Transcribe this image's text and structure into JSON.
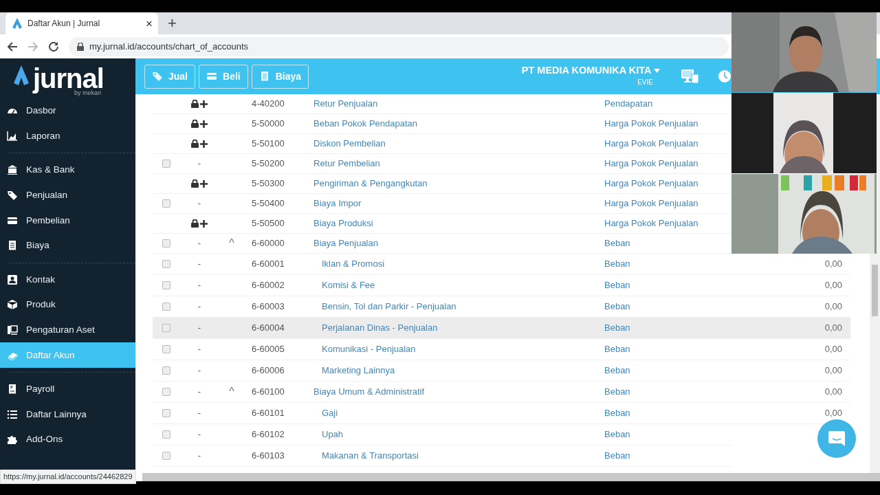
{
  "browser": {
    "tab_title": "Daftar Akun | Jurnal",
    "close": "×",
    "new_tab": "+",
    "url": "my.jurnal.id/accounts/chart_of_accounts",
    "forward_disabled": true
  },
  "sidebar": {
    "logo": "jurnal",
    "logo_sub": "by mekari",
    "groups": [
      {
        "items": [
          {
            "label": "Dasbor",
            "selected": false
          },
          {
            "label": "Laporan",
            "selected": false
          }
        ]
      },
      {
        "items": [
          {
            "label": "Kas & Bank",
            "selected": false
          },
          {
            "label": "Penjualan",
            "selected": false
          },
          {
            "label": "Pembelian",
            "selected": false
          },
          {
            "label": "Biaya",
            "selected": false
          }
        ]
      },
      {
        "items": [
          {
            "label": "Kontak",
            "selected": false
          },
          {
            "label": "Produk",
            "selected": false
          },
          {
            "label": "Pengaturan Aset",
            "selected": false
          },
          {
            "label": "Daftar Akun",
            "selected": true
          }
        ]
      },
      {
        "items": [
          {
            "label": "Payroll",
            "selected": false
          },
          {
            "label": "Daftar Lainnya",
            "selected": false
          },
          {
            "label": "Add-Ons",
            "selected": false
          }
        ]
      }
    ]
  },
  "header": {
    "buttons": [
      {
        "label": "Jual"
      },
      {
        "label": "Beli"
      },
      {
        "label": "Biaya"
      }
    ],
    "company": "PT MEDIA KOMUNIKA KITA",
    "user": "EVIE"
  },
  "table": {
    "rows": [
      {
        "kind": "locked",
        "code": "4-40200",
        "name": "Retur Penjualan",
        "category": "Pendapatan",
        "highlighted": false
      },
      {
        "kind": "locked",
        "code": "5-50000",
        "name": "Beban Pokok Pendapatan",
        "category": "Harga Pokok Penjualan",
        "highlighted": false
      },
      {
        "kind": "locked",
        "code": "5-50100",
        "name": "Diskon Pembelian",
        "category": "Harga Pokok Penjualan",
        "highlighted": false
      },
      {
        "kind": "checkbox",
        "checked": false,
        "dash": "-",
        "code": "5-50200",
        "name": "Retur Pembelian",
        "category": "Harga Pokok Penjualan",
        "highlighted": false
      },
      {
        "kind": "locked",
        "code": "5-50300",
        "name": "Pengiriman & Pengangkutan",
        "category": "Harga Pokok Penjualan",
        "highlighted": false
      },
      {
        "kind": "checkbox",
        "checked": false,
        "dash": "-",
        "code": "5-50400",
        "name": "Biaya Impor",
        "category": "Harga Pokok Penjualan",
        "highlighted": false
      },
      {
        "kind": "locked",
        "code": "5-50500",
        "name": "Biaya Produksi",
        "category": "Harga Pokok Penjualan",
        "highlighted": false
      },
      {
        "kind": "checkbox",
        "checked": false,
        "dash": "-",
        "toggle": "^",
        "code": "6-60000",
        "name": "Biaya Penjualan",
        "category": "Beban",
        "highlighted": false,
        "children": [
          {
            "kind": "checkbox",
            "checked": false,
            "dash": "-",
            "code": "6-60001",
            "name": "Iklan & Promosi",
            "category": "Beban",
            "balance": "0,00",
            "highlighted": false
          },
          {
            "kind": "checkbox",
            "checked": false,
            "dash": "-",
            "code": "6-60002",
            "name": "Komisi & Fee",
            "category": "Beban",
            "balance": "0,00",
            "highlighted": false
          },
          {
            "kind": "checkbox",
            "checked": false,
            "dash": "-",
            "code": "6-60003",
            "name": "Bensin, Tol dan Parkir - Penjualan",
            "category": "Beban",
            "balance": "0,00",
            "highlighted": false
          },
          {
            "kind": "checkbox",
            "checked": false,
            "dash": "-",
            "code": "6-60004",
            "name": "Perjalanan Dinas - Penjualan",
            "category": "Beban",
            "balance": "0,00",
            "highlighted": true
          },
          {
            "kind": "checkbox",
            "checked": false,
            "dash": "-",
            "code": "6-60005",
            "name": "Komunikasi - Penjualan",
            "category": "Beban",
            "balance": "0,00",
            "highlighted": false
          },
          {
            "kind": "checkbox",
            "checked": false,
            "dash": "-",
            "code": "6-60006",
            "name": "Marketing Lainnya",
            "category": "Beban",
            "balance": "0,00",
            "highlighted": false
          }
        ]
      },
      {
        "kind": "checkbox",
        "checked": false,
        "dash": "-",
        "toggle": "^",
        "code": "6-60100",
        "name": "Biaya Umum & Administratif",
        "category": "Beban",
        "balance": "0,00",
        "highlighted": false,
        "children": [
          {
            "kind": "checkbox",
            "checked": false,
            "dash": "-",
            "code": "6-60101",
            "name": "Gaji",
            "category": "Beban",
            "balance": "0,00",
            "highlighted": false
          },
          {
            "kind": "checkbox",
            "checked": false,
            "dash": "-",
            "code": "6-60102",
            "name": "Upah",
            "category": "Beban",
            "highlighted": false
          },
          {
            "kind": "checkbox",
            "checked": false,
            "dash": "-",
            "code": "6-60103",
            "name": "Makanan & Transportasi",
            "category": "Beban",
            "highlighted": false
          }
        ]
      }
    ]
  },
  "status_bar": "https://my.jurnal.id/accounts/24462829"
}
